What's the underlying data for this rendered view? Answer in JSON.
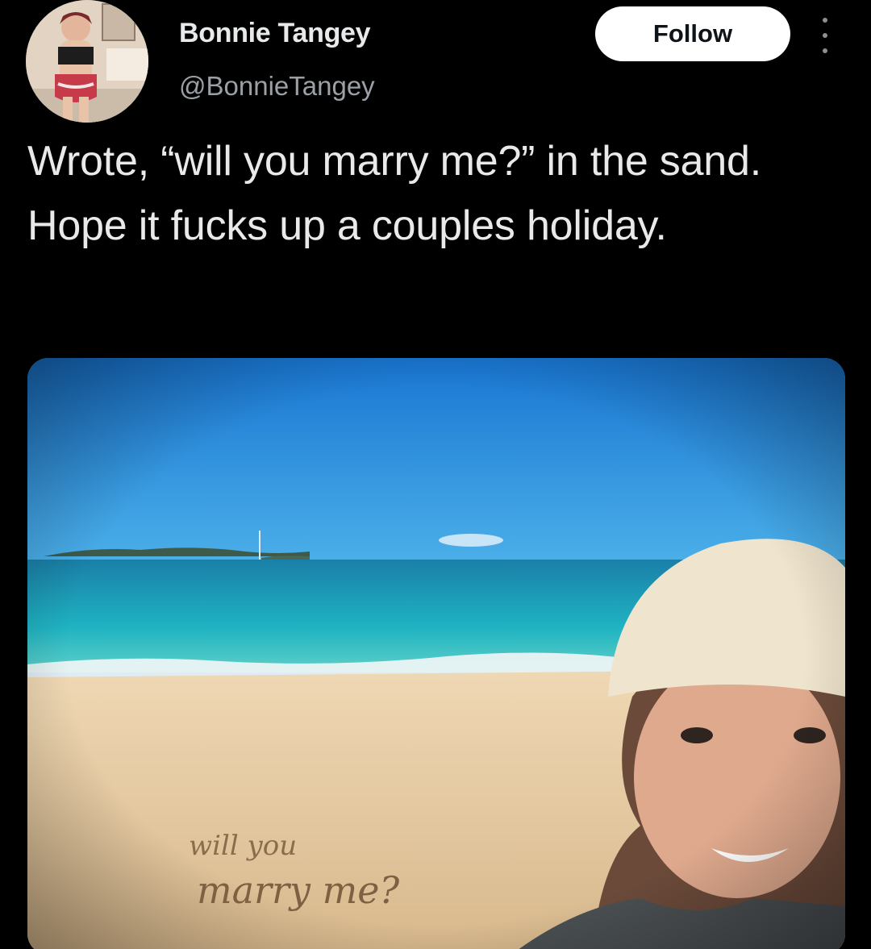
{
  "author": {
    "name": "Bonnie Tangey",
    "handle": "@BonnieTangey",
    "avatar_icon": "profile-avatar"
  },
  "actions": {
    "follow_label": "Follow",
    "more_icon": "more-vertical-icon"
  },
  "tweet": {
    "text": "Wrote, “will you marry me?” in the sand. Hope it fucks up a couples holiday."
  },
  "media": {
    "type": "photo",
    "sand_writing_line1": "will you",
    "sand_writing_line2": "marry me?"
  },
  "colors": {
    "background": "#000000",
    "text": "#e7e9ea",
    "secondary_text": "#9aa0a6",
    "follow_bg": "#ffffff",
    "follow_text": "#0f1419"
  }
}
